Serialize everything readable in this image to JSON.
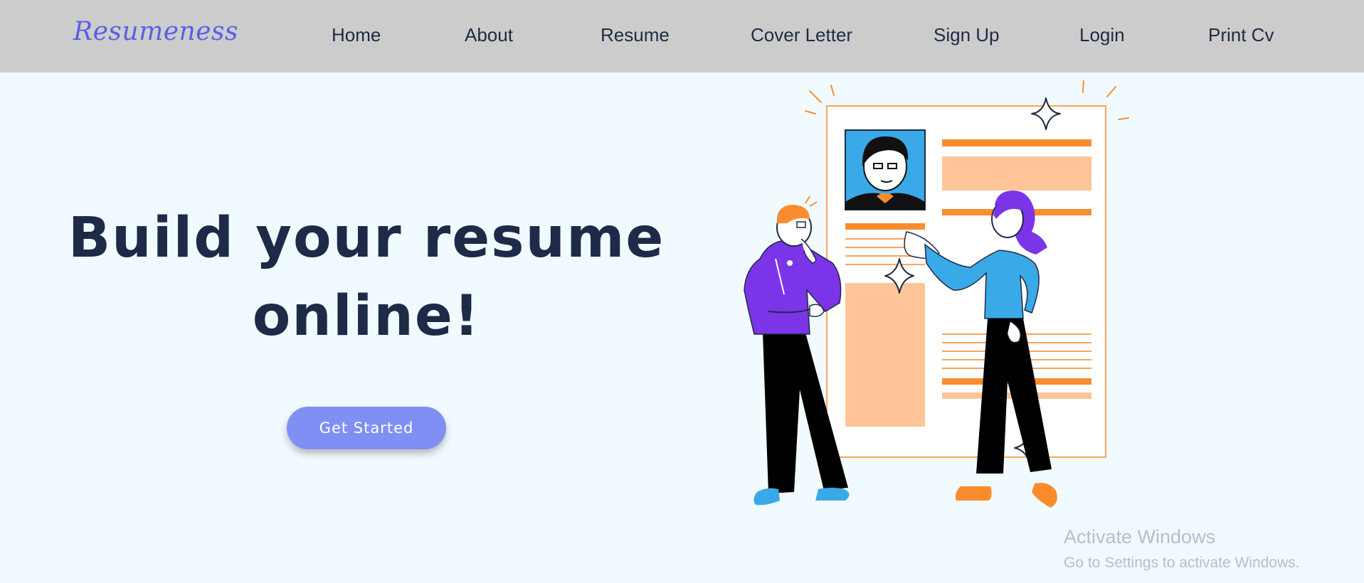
{
  "brand": {
    "name": "Resumeness"
  },
  "nav": {
    "items": [
      {
        "label": "Home"
      },
      {
        "label": "About"
      },
      {
        "label": "Resume"
      },
      {
        "label": "Cover Letter"
      },
      {
        "label": "Sign Up"
      },
      {
        "label": "Login"
      },
      {
        "label": "Print Cv"
      }
    ]
  },
  "hero": {
    "title_line1": "Build your resume",
    "title_line2": "online!",
    "cta_label": "Get Started"
  },
  "watermark": {
    "title": "Activate Windows",
    "subtitle": "Go to Settings to activate Windows."
  },
  "colors": {
    "navbar_bg": "#cccccc",
    "page_bg": "#f1fbff",
    "brand": "#5b5ee6",
    "heading": "#1e2a48",
    "cta": "#7f8ff3",
    "orange": "#fb8c2e",
    "peach": "#ffc598",
    "purple": "#7c34e8",
    "blue": "#3aa8ea"
  },
  "illustration": {
    "icon": "resume-people-illustration"
  }
}
